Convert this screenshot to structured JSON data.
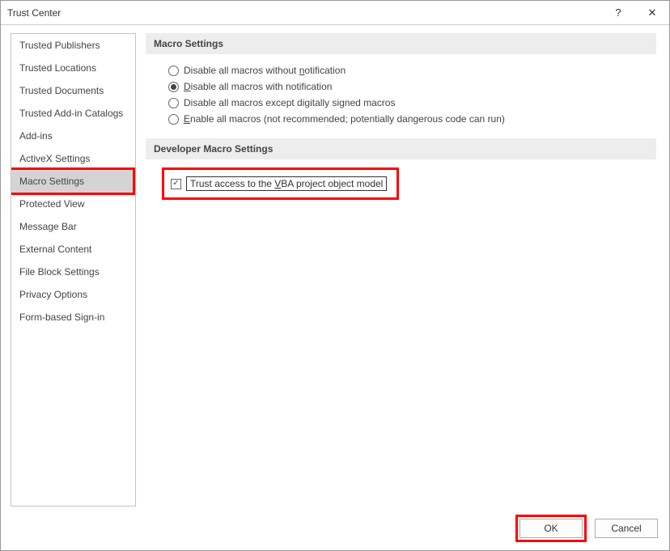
{
  "title": "Trust Center",
  "sidebar": {
    "items": [
      {
        "label": "Trusted Publishers"
      },
      {
        "label": "Trusted Locations"
      },
      {
        "label": "Trusted Documents"
      },
      {
        "label": "Trusted Add-in Catalogs"
      },
      {
        "label": "Add-ins"
      },
      {
        "label": "ActiveX Settings"
      },
      {
        "label": "Macro Settings",
        "selected": true
      },
      {
        "label": "Protected View"
      },
      {
        "label": "Message Bar"
      },
      {
        "label": "External Content"
      },
      {
        "label": "File Block Settings"
      },
      {
        "label": "Privacy Options"
      },
      {
        "label": "Form-based Sign-in"
      }
    ]
  },
  "sections": {
    "macro": {
      "header": "Macro Settings",
      "options": [
        {
          "label": "Disable all macros without notification",
          "checked": false
        },
        {
          "label": "Disable all macros with notification",
          "checked": true
        },
        {
          "label": "Disable all macros except digitally signed macros",
          "checked": false
        },
        {
          "label": "Enable all macros (not recommended; potentially dangerous code can run)",
          "checked": false
        }
      ]
    },
    "dev": {
      "header": "Developer Macro Settings",
      "checkbox": {
        "label": "Trust access to the VBA project object model",
        "checked": true
      }
    }
  },
  "footer": {
    "ok": "OK",
    "cancel": "Cancel"
  }
}
